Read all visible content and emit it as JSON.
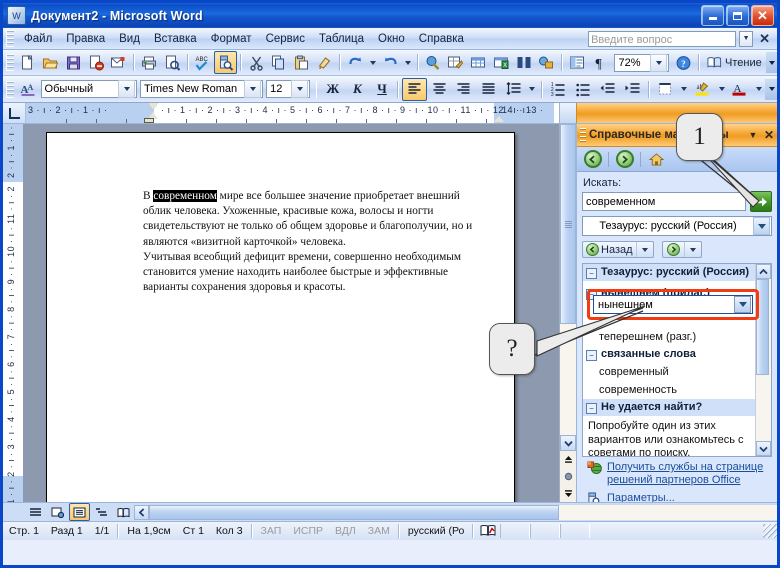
{
  "window": {
    "title": "Документ2 - Microsoft Word",
    "app_icon": "word-document-icon",
    "minimize": "minimize-icon",
    "maximize": "maximize-icon",
    "close": "close-icon"
  },
  "menubar": {
    "items": [
      {
        "label": "Файл",
        "accel": "Ф"
      },
      {
        "label": "Правка",
        "accel": "П"
      },
      {
        "label": "Вид",
        "accel": "В"
      },
      {
        "label": "Вставка",
        "accel": "т"
      },
      {
        "label": "Формат",
        "accel": "м"
      },
      {
        "label": "Сервис",
        "accel": "р"
      },
      {
        "label": "Таблица",
        "accel": "Т"
      },
      {
        "label": "Окно",
        "accel": "О"
      },
      {
        "label": "Справка",
        "accel": "С"
      }
    ],
    "ask_placeholder": "Введите вопрос",
    "close_label": "✕"
  },
  "toolbar_standard": {
    "zoom_value": "72%",
    "read_label": "Чтение",
    "buttons": [
      "new-document-icon",
      "open-folder-icon",
      "save-icon",
      "permission-icon",
      "email-icon",
      "print-icon",
      "print-preview-icon",
      "spelling-check-icon",
      "research-icon",
      "cut-scissors-icon",
      "copy-icon",
      "paste-icon",
      "format-painter-icon",
      "undo-icon",
      "redo-icon",
      "insert-hyperlink-icon",
      "tables-and-borders-icon",
      "insert-table-icon",
      "insert-excel-sheet-icon",
      "columns-icon",
      "drawing-icon",
      "document-map-icon",
      "show-formatting-icon",
      "help-icon",
      "reading-layout-icon"
    ]
  },
  "toolbar_formatting": {
    "style_value": "Обычный",
    "font_value": "Times New Roman",
    "size_value": "12",
    "bold_label": "Ж",
    "italic_label": "К",
    "underline_label": "Ч",
    "buttons": [
      "align-left-icon",
      "align-center-icon",
      "align-right-icon",
      "justify-icon",
      "line-spacing-icon",
      "numbered-list-icon",
      "bulleted-list-icon",
      "decrease-indent-icon",
      "increase-indent-icon",
      "borders-icon",
      "highlight-color-icon",
      "font-color-icon"
    ]
  },
  "ruler": {
    "horizontal_labels": [
      "3",
      "2",
      "1",
      "1",
      "2",
      "3",
      "4",
      "5",
      "6",
      "7",
      "8",
      "9",
      "10",
      "11",
      "12",
      "13",
      "14"
    ],
    "vertical_labels": [
      "2",
      "1",
      "1",
      "2",
      "3",
      "4",
      "5",
      "6",
      "7",
      "8",
      "9",
      "10",
      "11",
      "2"
    ]
  },
  "document": {
    "selected_word": "современном",
    "paragraph1_before": "В ",
    "paragraph1_after": " мире все большее значение приобретает внешний облик человека. Ухоженные, красивые кожа, волосы и ногти свидетельствуют не только об общем здоровье и благополучии, но и являются «визитной карточкой» человека.",
    "paragraph2": "Учитывая всеобщий дефицит времени, совершенно необходимым становится умение находить наиболее быстрые и эффективные варианты сохранения здоровья и красоты."
  },
  "taskpane": {
    "title": "Справочные материалы",
    "dropdown_icon": "chevron-down-icon",
    "close_icon": "close-icon",
    "nav_back_icon": "back-arrow-icon",
    "nav_forward_icon": "forward-arrow-icon",
    "nav_home_icon": "home-icon",
    "search_label": "Искать:",
    "search_value": "современном",
    "go_icon": "go-arrow-icon",
    "scope_value": "Тезаурус: русский (Россия)",
    "back_button": "Назад",
    "results": {
      "section_title": "Тезаурус: русский (Россия)",
      "group1_title": "нынешнем (прилаг.)",
      "selected_item": "нынешнем",
      "item2": "теперешнем (разг.)",
      "group2_title": "связанные слова",
      "item3": "современный",
      "item4": "современность"
    },
    "notfound": {
      "title": "Не удается найти?",
      "text": "Попробуйте один из этих вариантов или ознакомьтесь с советами по поиску,"
    },
    "links": [
      {
        "text": "Получить службы на странице решений партнеров Office",
        "icon": "office-marketplace-icon"
      },
      {
        "text": "Параметры...",
        "icon": "research-options-icon"
      }
    ]
  },
  "viewbar": {
    "buttons": [
      "normal-view-icon",
      "web-layout-view-icon",
      "print-layout-view-icon",
      "outline-view-icon",
      "reading-view-icon"
    ],
    "scroll_left_icon": "scroll-left-icon"
  },
  "statusbar": {
    "page_label": "Стр. 1",
    "section_label": "Разд 1",
    "pages_label": "1/1",
    "at_label": "На 1,9см",
    "line_label": "Ст 1",
    "col_label": "Кол 3",
    "rec": "ЗАП",
    "trk": "ИСПР",
    "ext": "ВДЛ",
    "ovr": "ЗАМ",
    "language": "русский (Ро",
    "spell_icon": "spellcheck-status-icon"
  },
  "callouts": [
    {
      "id": "callout-1",
      "label": "1"
    },
    {
      "id": "callout-question",
      "label": "?"
    }
  ],
  "colors": {
    "titlebar_blue": "#0b4fc8",
    "taskpane_orange": "#f7a938",
    "highlight_ring": "#f03c10",
    "go_green": "#3f9527",
    "link_blue": "#1b4e9b"
  }
}
